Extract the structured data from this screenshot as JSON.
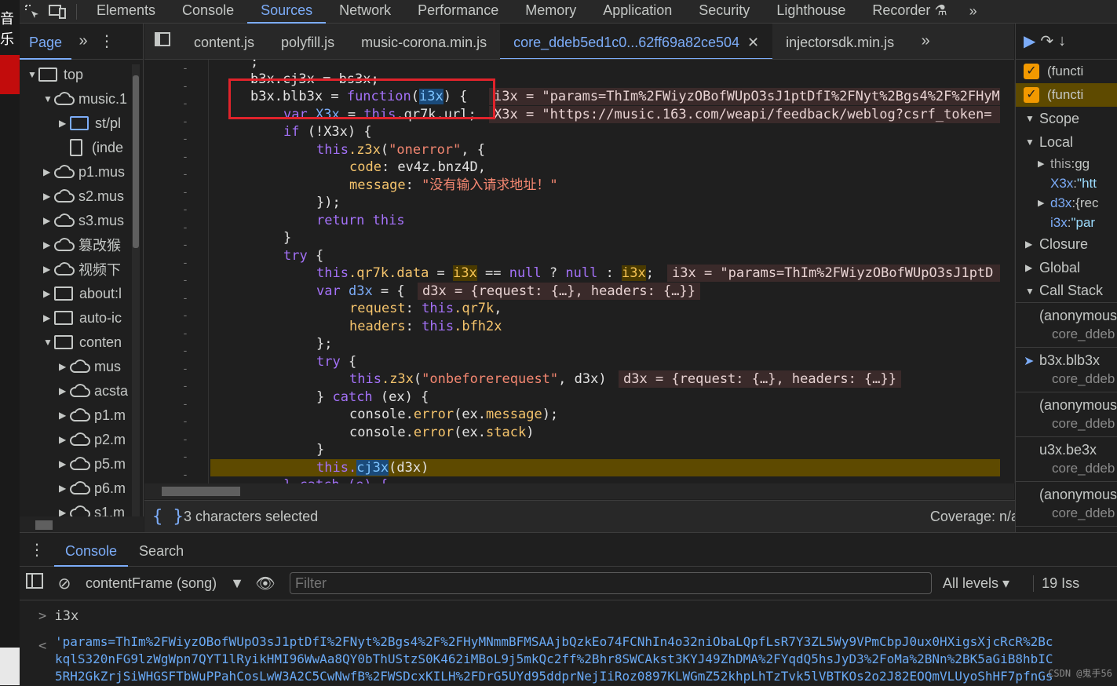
{
  "main_tabs": [
    "Elements",
    "Console",
    "Sources",
    "Network",
    "Performance",
    "Memory",
    "Application",
    "Security",
    "Lighthouse",
    "Recorder"
  ],
  "active_main_tab": "Sources",
  "navigator": {
    "page_tab": "Page",
    "tree": [
      {
        "label": "top",
        "icon": "frame-icon",
        "depth": 0,
        "arrow": "down"
      },
      {
        "label": "music.1",
        "icon": "cloud-icon",
        "depth": 1,
        "arrow": "down"
      },
      {
        "label": "st/pl",
        "icon": "folder-icon",
        "depth": 2,
        "arrow": "right"
      },
      {
        "label": "(inde",
        "icon": "file-icon",
        "depth": 2,
        "arrow": ""
      },
      {
        "label": "p1.mus",
        "icon": "cloud-icon",
        "depth": 1,
        "arrow": "right"
      },
      {
        "label": "s2.mus",
        "icon": "cloud-icon",
        "depth": 1,
        "arrow": "right"
      },
      {
        "label": "s3.mus",
        "icon": "cloud-icon",
        "depth": 1,
        "arrow": "right"
      },
      {
        "label": "篡改猴",
        "icon": "cloud-icon",
        "depth": 1,
        "arrow": "right"
      },
      {
        "label": "视频下",
        "icon": "cloud-icon",
        "depth": 1,
        "arrow": "right"
      },
      {
        "label": "about:l",
        "icon": "frame-icon",
        "depth": 1,
        "arrow": "right"
      },
      {
        "label": "auto-ic",
        "icon": "frame-icon",
        "depth": 1,
        "arrow": "right"
      },
      {
        "label": "conten",
        "icon": "frame-icon",
        "depth": 1,
        "arrow": "down"
      },
      {
        "label": "mus",
        "icon": "cloud-icon",
        "depth": 2,
        "arrow": "right"
      },
      {
        "label": "acsta",
        "icon": "cloud-icon",
        "depth": 2,
        "arrow": "right"
      },
      {
        "label": "p1.m",
        "icon": "cloud-icon",
        "depth": 2,
        "arrow": "right"
      },
      {
        "label": "p2.m",
        "icon": "cloud-icon",
        "depth": 2,
        "arrow": "right"
      },
      {
        "label": "p5.m",
        "icon": "cloud-icon",
        "depth": 2,
        "arrow": "right"
      },
      {
        "label": "p6.m",
        "icon": "cloud-icon",
        "depth": 2,
        "arrow": "right"
      },
      {
        "label": "s1.m",
        "icon": "cloud-icon",
        "depth": 2,
        "arrow": "right"
      }
    ]
  },
  "editor_tabs": [
    "content.js",
    "polyfill.js",
    "music-corona.min.js",
    "core_ddeb5ed1c0...62ff69a82ce504",
    "injectorsdk.min.js"
  ],
  "active_editor_tab": "core_ddeb5ed1c0...62ff69a82ce504",
  "code": {
    "l0": ";",
    "l1_obj": "b3x.cj3x = bs3x;",
    "l2_a": "b3x.blb3x = ",
    "l2_kw": "function",
    "l2_param": "i3x",
    "l2_end": ") {",
    "l3": "var X3x = this.qr7k.url;",
    "l4": "if (!X3x) {",
    "l5_a": "this.z3x(",
    "l5_s": "\"onerror\"",
    "l5_b": ", {",
    "l6_p": "code",
    "l6_v": ": ev4z.bnz4D,",
    "l7_p": "message",
    "l7_s": "\"没有输入请求地址！\"",
    "l8": "});",
    "l9": "return this",
    "l10": "}",
    "l11": "try {",
    "l12_a": "this.qr7k.data = ",
    "l12_b": " == ",
    "l12_n": "null",
    "l12_c": " ? ",
    "l12_d": " : ",
    "l13_a": "var d3x = {",
    "l14_p": "request",
    "l14_v": ": this.qr7k,",
    "l15_p": "headers",
    "l15_v": ": this.bfh2x",
    "l16": "};",
    "l17": "try {",
    "l18_a": "this.z3x(",
    "l18_s": "\"onbeforerequest\"",
    "l18_b": ", d3x)",
    "l19_kw": "catch",
    "l19_b": " (ex) {",
    "l20": "console.error(ex.message);",
    "l21": "console.error(ex.stack)",
    "l22": "}",
    "l23_a": "this.",
    "l23_sel": "cj3x",
    "l23_b": "(d3x)"
  },
  "overlays": {
    "o1": "i3x = \"params=ThIm%2FWiyzOBofWUpO3sJ1ptDfI%2FNyt%2Bgs4%2F%2FHyMl",
    "o2": "X3x = \"https://music.163.com/weapi/feedback/weblog?csrf_token=",
    "o3": "i3x = \"params=ThIm%2FWiyzOBofWUpO3sJ1ptD",
    "o4": "d3x = {request: {…}, headers: {…}}",
    "o5": "d3x = {request: {…}, headers: {…}}"
  },
  "status": {
    "selection": "3 characters selected",
    "coverage": "Coverage: n/a"
  },
  "debugger": {
    "breakpoints": [
      "(functi",
      "(functi"
    ],
    "scope_label": "Scope",
    "local_label": "Local",
    "locals": [
      {
        "name": "this",
        "value": "gg"
      },
      {
        "name": "X3x",
        "value": "\"htt"
      },
      {
        "name": "d3x",
        "value": "{rec"
      },
      {
        "name": "i3x",
        "value": "\"par"
      }
    ],
    "closure_label": "Closure",
    "global_label": "Global",
    "callstack_label": "Call Stack",
    "frames": [
      {
        "name": "(anonymous",
        "file": "core_ddeb"
      },
      {
        "name": "b3x.blb3x",
        "file": "core_ddeb"
      },
      {
        "name": "(anonymous",
        "file": "core_ddeb"
      },
      {
        "name": "u3x.be3x",
        "file": "core_ddeb"
      },
      {
        "name": "(anonymous",
        "file": "core_ddeb"
      }
    ]
  },
  "drawer": {
    "tabs": [
      "Console",
      "Search"
    ],
    "active": "Console",
    "context": "contentFrame (song)",
    "filter_placeholder": "Filter",
    "levels": "All levels",
    "issues": "19 Iss",
    "input": "i3x",
    "output_lines": [
      "'params=ThIm%2FWiyzOBofWUpO3sJ1ptDfI%2FNyt%2Bgs4%2F%2FHyMNmmBFMSAAjbQzkEo74FCNhIn4o32niObaLQpfLsR7Y3ZL5Wy9VPmCbpJ0ux0HXigsXjcRcR%2Bc",
      "kqlS320nFG9lzWgWpn7QYT1lRyikHMI96WwAa8QY0bThUStzS0K462iMBoL9j5mkQc2ff%2Bhr8SWCAkst3KYJ49ZhDMA%2FYqdQ5hsJyD3%2FoMa%2BNn%2BK5aGiB8hbIC",
      "5RH2GkZrjSiWHGSFTbWuPPahCosLwW3A2C5CwNwfB%2FWSDcxKILH%2FDrG5UYd95ddprNejIiRoz0897KLWGmZ52khpLhTzTvk5lVBTKOs2o2J82EOQmVLUyoShHF7pfnGs"
    ],
    "watermark": "CSDN @鬼手56"
  },
  "left_strip_text": "音乐"
}
